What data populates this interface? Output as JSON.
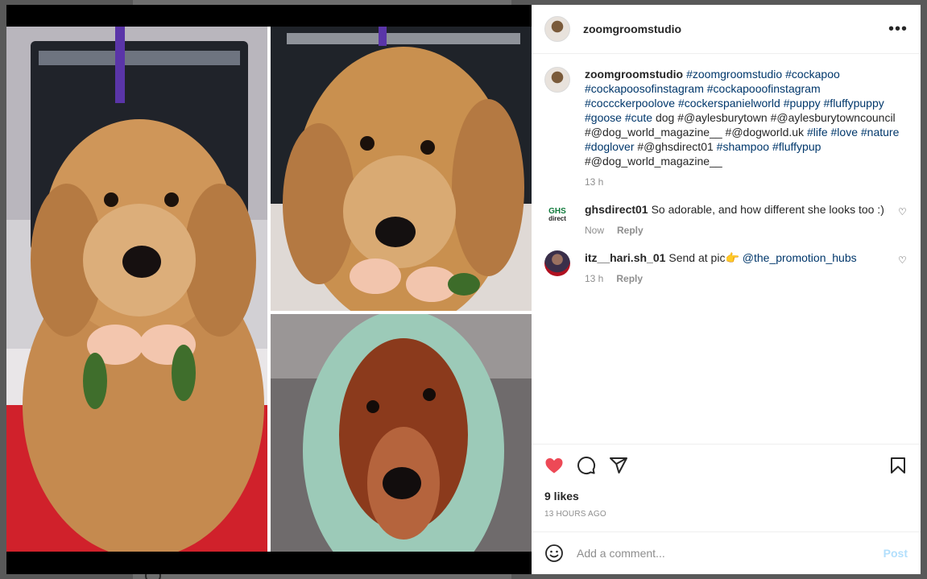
{
  "post": {
    "username": "zoomgroomstudio",
    "more_icon": "more-horizontal-icon",
    "caption_parts": [
      {
        "text": "#zoomgroomstudio",
        "tag": true
      },
      {
        "text": " ",
        "tag": false
      },
      {
        "text": "#cockapoo",
        "tag": true
      },
      {
        "text": " ",
        "tag": false
      },
      {
        "text": "#cockapoosofinstagram",
        "tag": true
      },
      {
        "text": " ",
        "tag": false
      },
      {
        "text": "#cockapooofinstagram",
        "tag": true
      },
      {
        "text": " ",
        "tag": false
      },
      {
        "text": "#coccckerpoolove",
        "tag": true
      },
      {
        "text": " ",
        "tag": false
      },
      {
        "text": "#cockerspanielworld",
        "tag": true
      },
      {
        "text": " ",
        "tag": false
      },
      {
        "text": "#puppy",
        "tag": true
      },
      {
        "text": " ",
        "tag": false
      },
      {
        "text": "#fluffypuppy",
        "tag": true
      },
      {
        "text": " ",
        "tag": false
      },
      {
        "text": "#goose",
        "tag": true
      },
      {
        "text": " ",
        "tag": false
      },
      {
        "text": "#cute",
        "tag": true
      },
      {
        "text": " dog #@aylesburytown #@aylesburytowncouncil #@dog_world_magazine__ #@dogworld.uk ",
        "tag": false
      },
      {
        "text": "#life",
        "tag": true
      },
      {
        "text": " ",
        "tag": false
      },
      {
        "text": "#love",
        "tag": true
      },
      {
        "text": " ",
        "tag": false
      },
      {
        "text": "#nature",
        "tag": true
      },
      {
        "text": " ",
        "tag": false
      },
      {
        "text": "#doglover",
        "tag": true
      },
      {
        "text": " #@ghsdirect01 ",
        "tag": false
      },
      {
        "text": "#shampoo",
        "tag": true
      },
      {
        "text": " ",
        "tag": false
      },
      {
        "text": "#fluffypup",
        "tag": true
      },
      {
        "text": " #@dog_world_magazine__",
        "tag": false
      }
    ],
    "caption_time": "13 h"
  },
  "comments": [
    {
      "username": "ghsdirect01",
      "avatar_text": "GHS",
      "avatar_sub": "direct",
      "text": "So adorable, and how different she looks too :)",
      "time": "Now",
      "reply_label": "Reply"
    },
    {
      "username": "itz__hari.sh_01",
      "text": "Send at pic👉 ",
      "mention": "@the_promotion_hubs",
      "time": "13 h",
      "reply_label": "Reply"
    }
  ],
  "actions": {
    "like_icon": "heart-filled-icon",
    "comment_icon": "comment-icon",
    "share_icon": "share-icon",
    "save_icon": "bookmark-icon",
    "like_color": "#ed4956",
    "likes": "9 likes",
    "timestamp": "13 HOURS AGO"
  },
  "composer": {
    "emoji_icon": "emoji-icon",
    "placeholder": "Add a comment...",
    "post_label": "Post",
    "post_color": "#b2dffc"
  },
  "colors": {
    "hashtag": "#00376b",
    "muted": "#8e8e8e"
  }
}
